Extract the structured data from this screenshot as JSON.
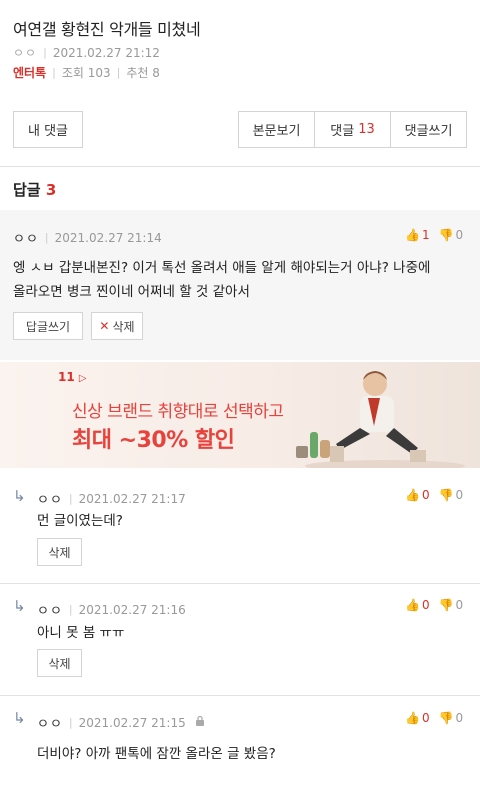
{
  "post": {
    "title": "여연갤 황현진 악개들 미쳤네",
    "author": "ㅇㅇ",
    "date": "2021.02.27 21:12",
    "category": "엔터톡",
    "views": "조회 103",
    "recommends": "추천 8"
  },
  "toolbar": {
    "my_comments": "내 댓글",
    "view_body": "본문보기",
    "comments_label": "댓글",
    "comments_count": "13",
    "write_comment": "댓글쓰기"
  },
  "replies_header": {
    "label": "답글",
    "count": "3"
  },
  "best_comment": {
    "author": "ㅇㅇ",
    "date": "2021.02.27 21:14",
    "up": "1",
    "down": "0",
    "text_line1": "엥 ㅅㅂ 갑분내본진? 이거 톡선 올려서 애들 알게 해야되는거 아냐? 나중에",
    "text_line2": "올라오면 병크 찐이네 어쩌네 할 것 같아서",
    "reply_button": "답글쓰기",
    "delete_button": "삭제"
  },
  "ad": {
    "logo": "11",
    "line1": "신상 브랜드 취향대로 선택하고",
    "line2": "최대 ~30% 할인"
  },
  "replies": [
    {
      "author": "ㅇㅇ",
      "date": "2021.02.27 21:17",
      "up": "0",
      "down": "0",
      "text": "먼 글이였는데?",
      "delete_button": "삭제"
    },
    {
      "author": "ㅇㅇ",
      "date": "2021.02.27 21:16",
      "up": "0",
      "down": "0",
      "text": "아니 못 봄 ㅠㅠ",
      "delete_button": "삭제"
    },
    {
      "author": "ㅇㅇ",
      "date": "2021.02.27 21:15",
      "up": "0",
      "down": "0",
      "text": "더비야? 아까 팬톡에 잠깐 올라온 글 봤음?"
    }
  ],
  "icons": {
    "thumb_up": "thumb-up-icon",
    "thumb_down": "thumb-down-icon",
    "reply_arrow": "reply-arrow-icon",
    "lock": "lock-icon"
  },
  "colors": {
    "accent": "#d9302a",
    "muted": "#999999",
    "best_bg": "#f6f6f6"
  }
}
